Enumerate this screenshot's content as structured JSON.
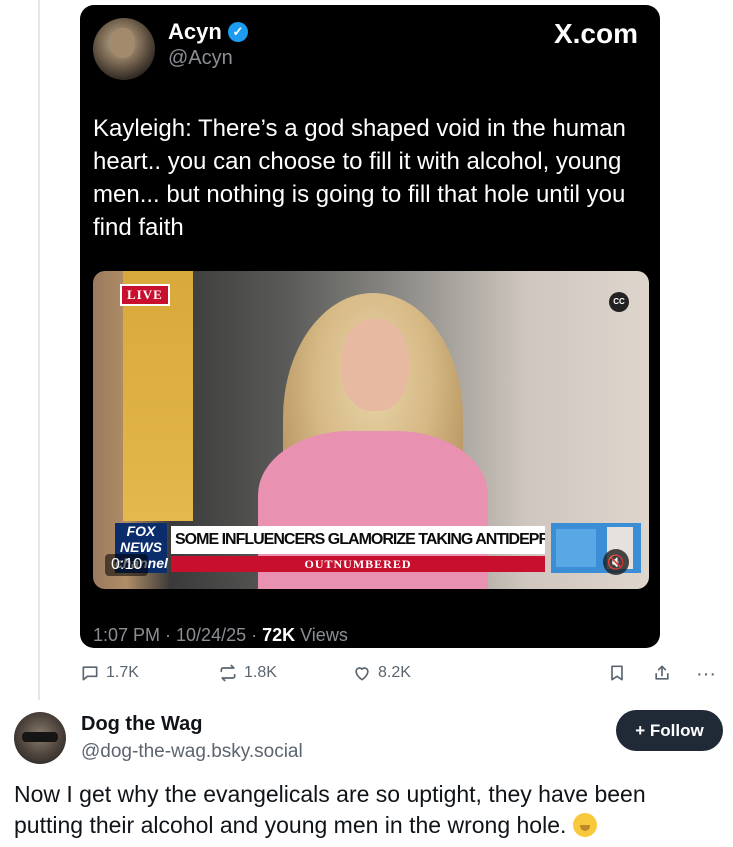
{
  "embedded_post": {
    "author_name": "Acyn",
    "author_handle": "@Acyn",
    "source": "X.com",
    "text": "Kayleigh: There’s a god shaped void in the human heart.. you can choose to fill it with alcohol, young men... but nothing is going to fill that hole until you find faith",
    "video": {
      "live_badge": "LIVE",
      "cc_label": "CC",
      "network_logo": "FOX NEWS channel",
      "headline": "SOME INFLUENCERS GLAMORIZE TAKING ANTIDEPRESSANTS",
      "show_name": "OUTNUMBERED",
      "elapsed": "0:10",
      "mute_icon": "speaker-muted-icon"
    },
    "timestamp": "1:07 PM · 10/24/25 · ",
    "views_count": "72K",
    "views_label": " Views"
  },
  "actions": {
    "replies": "1.7K",
    "reposts": "1.8K",
    "likes": "8.2K",
    "more": "···"
  },
  "post": {
    "author_name": "Dog the Wag",
    "author_handle": "@dog-the-wag.bsky.social",
    "follow_label": "+ Follow",
    "text": "Now I get why the evangelicals are so uptight, they have been putting their alcohol and young men in the wrong hole."
  },
  "colors": {
    "verified": "#1d9bf0",
    "follow_bg": "#1f2a36",
    "live_red": "#c8102e"
  }
}
